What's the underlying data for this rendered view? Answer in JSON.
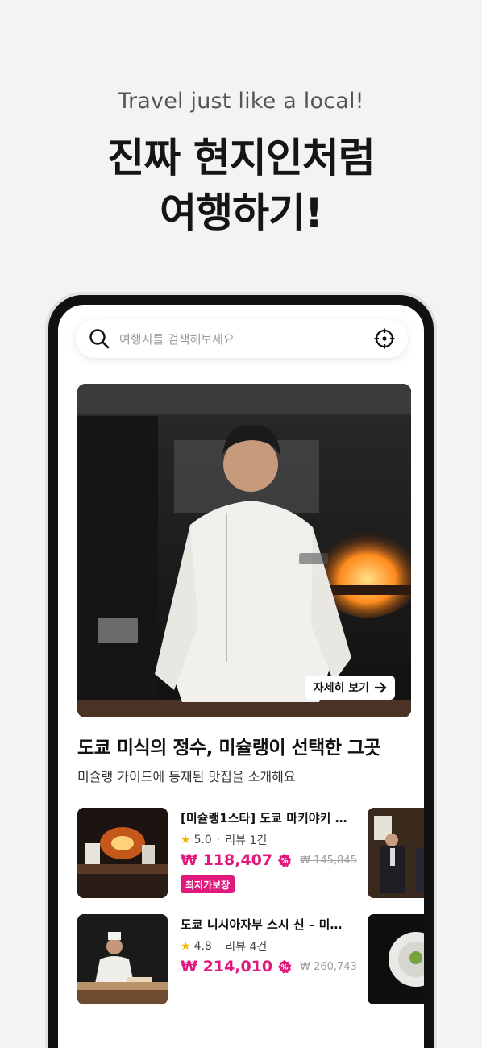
{
  "promo": {
    "tagline": "Travel just like a local!",
    "headline_line1": "진짜 현지인처럼",
    "headline_line2": "여행하기!"
  },
  "search": {
    "placeholder": "여행지를 검색해보세요",
    "icon": "search-icon",
    "right_icon": "locate-icon"
  },
  "hero": {
    "detail_label": "자세히 보기",
    "arrow_icon": "arrow-right-icon"
  },
  "section": {
    "title": "도쿄 미식의 정수, 미슐랭이 선택한 그곳",
    "subtitle": "미슐랭 가이드에 등재된 맛집을 소개해요"
  },
  "products": [
    {
      "name": "[미슐랭1스타] 도쿄 마키야키 …",
      "rating": "5.0",
      "reviews": "리뷰 1건",
      "price": "₩ 118,407",
      "original_price": "₩ 145,845",
      "tag": "최저가보장"
    },
    {
      "name": "도쿄 니시아자부 스시 신 – 미…",
      "rating": "4.8",
      "reviews": "리뷰 4건",
      "price": "₩ 214,010",
      "original_price": "₩ 260,743",
      "tag": ""
    }
  ],
  "colors": {
    "accent": "#e0197d",
    "star": "#f5b301",
    "background": "#f3f3f3",
    "phone_frame": "#111111"
  }
}
